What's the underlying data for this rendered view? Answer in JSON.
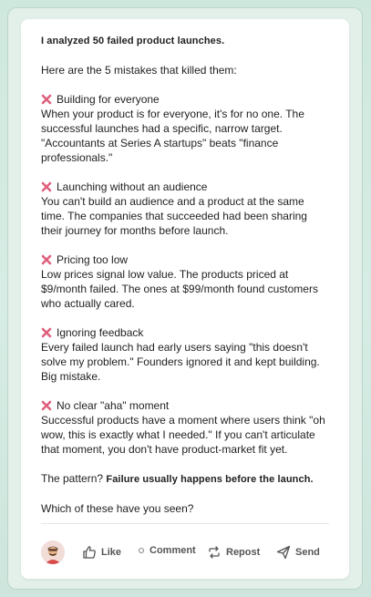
{
  "post": {
    "hook": "I analyzed 50 failed product launches.",
    "intro": "Here are the 5 mistakes that killed them:",
    "mistakes": [
      {
        "title": "Building for everyone",
        "lines": [
          "When your product is for everyone, it's for no one. The",
          "successful launches had a specific, narrow target.",
          "\"Accountants at Series A startups\" beats \"finance",
          "professionals.\""
        ]
      },
      {
        "title": "Launching without an audience",
        "lines": [
          "You can't build an audience and a product at the same",
          "time. The companies that succeeded had been sharing",
          "their journey for months before launch."
        ]
      },
      {
        "title": "Pricing too low",
        "lines": [
          "Low prices signal low value. The products priced at",
          "$9/month failed. The ones at $99/month found customers",
          "who actually cared."
        ]
      },
      {
        "title": "Ignoring feedback",
        "lines": [
          "Every failed launch had early users saying \"this doesn't",
          "solve my problem.\" Founders ignored it and kept building.",
          "Big mistake."
        ]
      },
      {
        "title": "No clear \"aha\" moment",
        "lines": [
          "Successful products have a moment where users think \"oh",
          "wow, this is exactly what I needed.\" If you can't articulate",
          "that moment, you don't have product-market fit yet."
        ]
      }
    ],
    "pattern_prefix": "The pattern? ",
    "pattern_bold": "Failure usually happens before the launch.",
    "question": "Which of these have you seen?"
  },
  "actions": {
    "like": "Like",
    "comment": "Comment",
    "repost": "Repost",
    "send": "Send"
  },
  "colors": {
    "cross": "#e0607e",
    "background": "#d2e9df",
    "card": "#ffffff"
  }
}
